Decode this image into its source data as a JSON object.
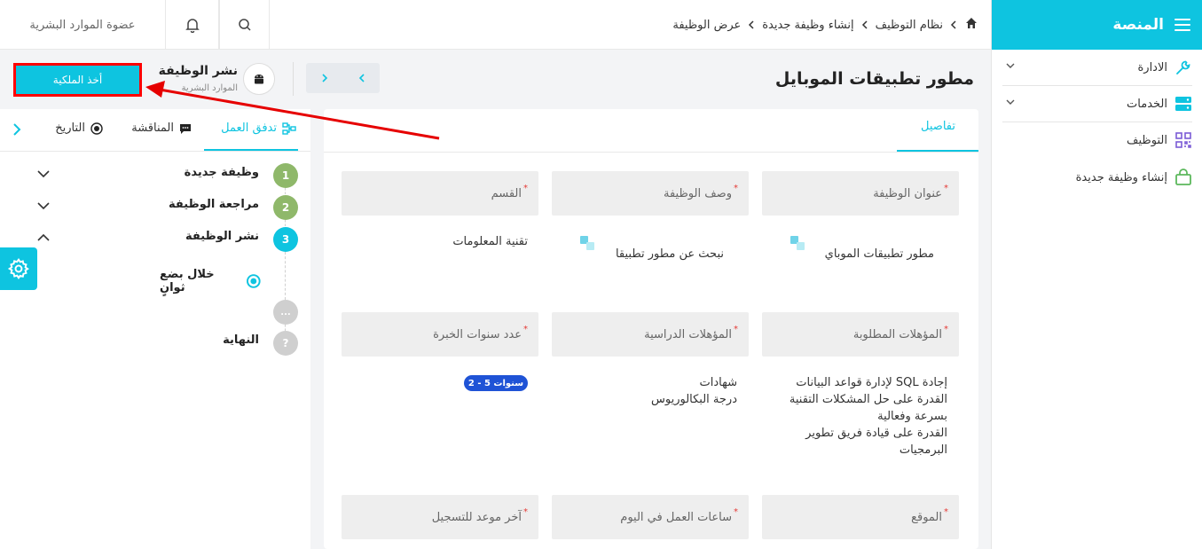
{
  "sidebar": {
    "brand": "المنصة",
    "items": [
      {
        "label": "الادارة"
      },
      {
        "label": "الخدمات"
      },
      {
        "label": "التوظيف"
      },
      {
        "label": "إنشاء وظيفة جديدة"
      }
    ]
  },
  "topbar": {
    "breadcrumb": [
      "نظام التوظيف",
      "إنشاء وظيفة جديدة",
      "عرض الوظيفة"
    ],
    "user": "عضوة الموارد البشرية"
  },
  "header": {
    "job_title": "مطور تطبيقات الموبايل",
    "stage_title": "نشر الوظيفة",
    "stage_subtitle": "الموارد البشرية",
    "take_ownership": "أخذ الملكية"
  },
  "details": {
    "tab": "تفاصيل",
    "fields": [
      {
        "label": "عنوان الوظيفة",
        "value": "مطور تطبيقات الموباي"
      },
      {
        "label": "وصف الوظيفة",
        "value": "نبحث عن مطور تطبيقا"
      },
      {
        "label": "القسم",
        "value": "تقنية المعلومات"
      },
      {
        "label": "المؤهلات المطلوبة",
        "value": "إجادة SQL لإدارة قواعد البيانات\nالقدرة على حل المشكلات التقنية بسرعة وفعالية\nالقدرة على قيادة فريق تطوير البرمجيات"
      },
      {
        "label": "المؤهلات الدراسية",
        "value": "شهادات\nدرجة البكالوريوس"
      },
      {
        "label": "عدد سنوات الخبرة",
        "value": "2 - 5 سنوات"
      },
      {
        "label": "الموقع"
      },
      {
        "label": "ساعات العمل في اليوم"
      },
      {
        "label": "آخر موعد للتسجيل"
      }
    ]
  },
  "panel": {
    "tabs": [
      "تدفق العمل",
      "المناقشة",
      "التاريخ"
    ],
    "steps": [
      {
        "number": "1",
        "label": "وظيفة جديدة",
        "color": "#8fb86a"
      },
      {
        "number": "2",
        "label": "مراجعة الوظيفة",
        "color": "#8fb86a"
      },
      {
        "number": "3",
        "label": "نشر الوظيفة",
        "color": "#0ec4e0"
      },
      {
        "number": "...",
        "label": "",
        "color": "#cfcfcf"
      },
      {
        "number": "?",
        "label": "النهاية",
        "color": "#cfcfcf"
      }
    ],
    "substep": "خلال بضع ثوانٍ"
  },
  "colors": {
    "accent": "#0ec4e0",
    "highlight": "#ff0000",
    "badge": "#1f53d6"
  }
}
